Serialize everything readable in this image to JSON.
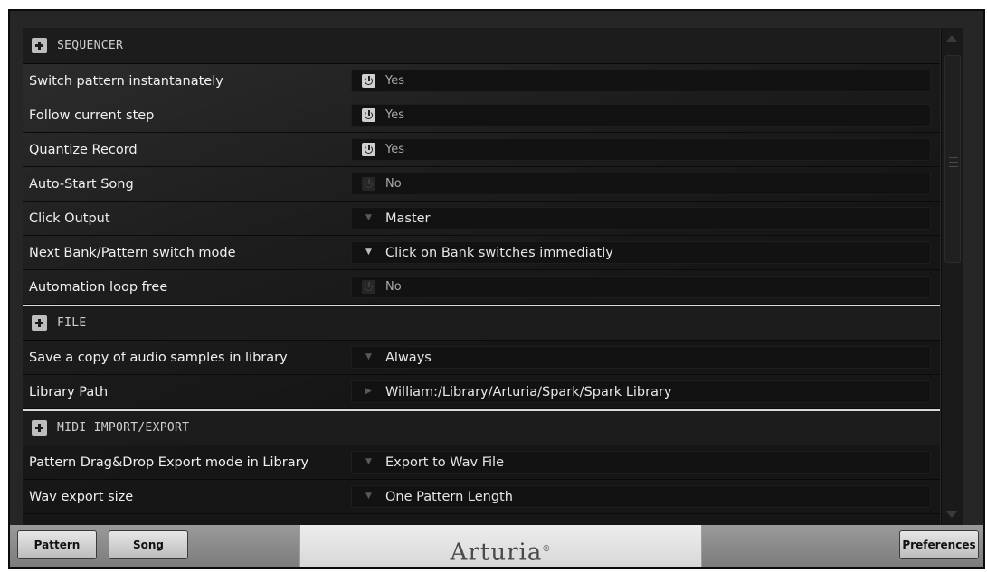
{
  "sections": [
    {
      "title": "SEQUENCER",
      "rows": [
        {
          "label": "Switch pattern instantanately",
          "control": "toggle-on",
          "value": "Yes"
        },
        {
          "label": "Follow current step",
          "control": "toggle-on",
          "value": "Yes"
        },
        {
          "label": "Quantize Record",
          "control": "toggle-on",
          "value": "Yes"
        },
        {
          "label": "Auto-Start Song",
          "control": "toggle-off",
          "value": "No"
        },
        {
          "label": "Click Output",
          "control": "dropdown-dim",
          "value": "Master"
        },
        {
          "label": "Next Bank/Pattern switch mode",
          "control": "dropdown",
          "value": "Click on Bank switches immediatly"
        },
        {
          "label": "Automation loop free",
          "control": "toggle-off",
          "value": "No"
        }
      ]
    },
    {
      "title": "FILE",
      "rows": [
        {
          "label": "Save a copy of audio samples in library",
          "control": "dropdown-dim",
          "value": "Always"
        },
        {
          "label": "Library Path",
          "control": "arrow-right",
          "value": "William:/Library/Arturia/Spark/Spark Library"
        }
      ]
    },
    {
      "title": "MIDI IMPORT/EXPORT",
      "rows": [
        {
          "label": "Pattern Drag&Drop Export mode in Library",
          "control": "dropdown-dim",
          "value": "Export to Wav File"
        },
        {
          "label": "Wav export size",
          "control": "dropdown-dim",
          "value": "One Pattern Length"
        }
      ]
    }
  ],
  "bottom_bar": {
    "pattern_label": "Pattern",
    "song_label": "Song",
    "logo_text": "Arturia",
    "logo_mark": "®",
    "preferences_label": "Preferences"
  }
}
